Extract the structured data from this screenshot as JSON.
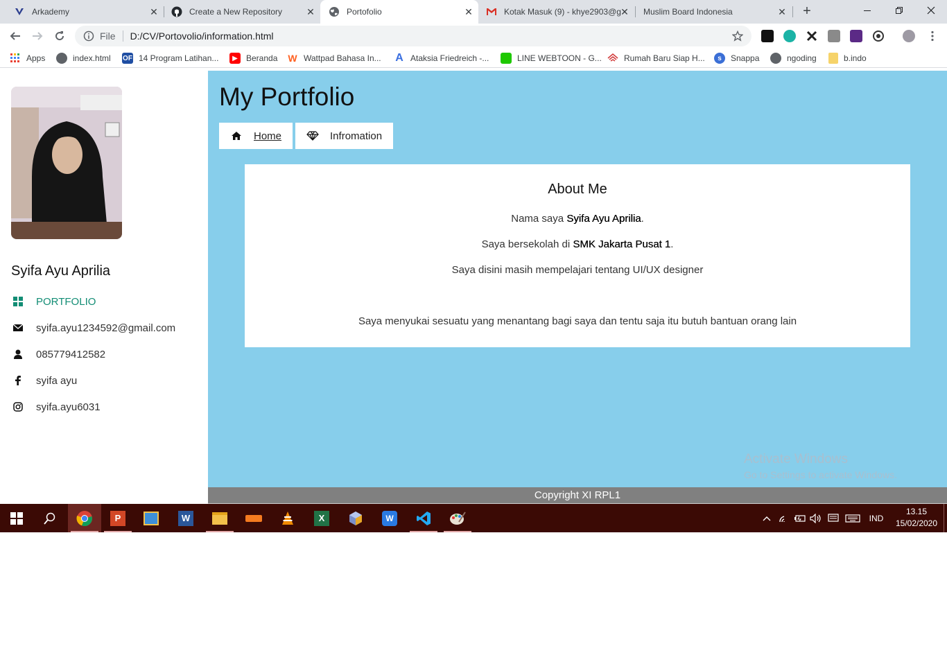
{
  "browser": {
    "tabs": [
      {
        "title": "Arkademy",
        "icon": "arkademy-icon"
      },
      {
        "title": "Create a New Repository",
        "icon": "github-icon"
      },
      {
        "title": "Portofolio",
        "icon": "globe-icon"
      },
      {
        "title": "Kotak Masuk (9) - khye2903@g",
        "icon": "gmail-icon"
      },
      {
        "title": "Muslim Board Indonesia",
        "icon": ""
      }
    ],
    "address": {
      "scheme": "File",
      "url": "D:/CV/Portovolio/information.html"
    },
    "bookmarks": [
      {
        "label": "Apps",
        "icon": "apps-grid-icon"
      },
      {
        "label": "index.html",
        "icon": "globe-icon"
      },
      {
        "label": "14 Program Latihan...",
        "icon": "bookmark-icon"
      },
      {
        "label": "Beranda",
        "icon": "youtube-icon"
      },
      {
        "label": "Wattpad Bahasa In...",
        "icon": "wattpad-icon"
      },
      {
        "label": "Ataksia Friedreich -...",
        "icon": "letter-a-icon"
      },
      {
        "label": "LINE WEBTOON - G...",
        "icon": "webtoon-icon"
      },
      {
        "label": "Rumah Baru Siap H...",
        "icon": "house-icon"
      },
      {
        "label": "Snappa",
        "icon": "snappa-icon"
      },
      {
        "label": "ngoding",
        "icon": "globe-icon"
      },
      {
        "label": "b.indo",
        "icon": "folder-icon"
      }
    ]
  },
  "sidebar": {
    "name": "Syifa Ayu Aprilia",
    "items": [
      {
        "label": "PORTFOLIO",
        "icon": "grid-icon"
      },
      {
        "label": "syifa.ayu1234592@gmail.com",
        "icon": "envelope-icon"
      },
      {
        "label": "085779412582",
        "icon": "user-icon"
      },
      {
        "label": "syifa ayu",
        "icon": "facebook-icon"
      },
      {
        "label": "syifa.ayu6031",
        "icon": "instagram-icon"
      }
    ]
  },
  "main": {
    "title": "My Portfolio",
    "nav": [
      {
        "label": "Home",
        "icon": "home-icon"
      },
      {
        "label": "Infromation",
        "icon": "diamond-icon"
      }
    ],
    "card": {
      "heading": "About Me",
      "line1_pre": "Nama saya ",
      "line1_bold": "Syifa Ayu Aprilia",
      "line1_post": ".",
      "line2_pre": "Saya bersekolah di ",
      "line2_bold": "SMK Jakarta Pusat 1",
      "line2_post": ".",
      "line3": "Saya disini masih mempelajari tentang UI/UX designer",
      "line4": "Saya menyukai sesuatu yang menantang bagi saya dan tentu saja itu butuh bantuan orang lain"
    },
    "watermark": {
      "title": "Activate Windows",
      "subtitle": "Go to Settings to activate Windows."
    },
    "footer": "Copyright XI RPL1"
  },
  "taskbar": {
    "language": "IND",
    "time": "13.15",
    "date": "15/02/2020"
  },
  "colors": {
    "main_bg": "#87ceeb",
    "accent": "#138d75",
    "footer_bg": "#808080",
    "taskbar_bg": "#3b0a05"
  }
}
